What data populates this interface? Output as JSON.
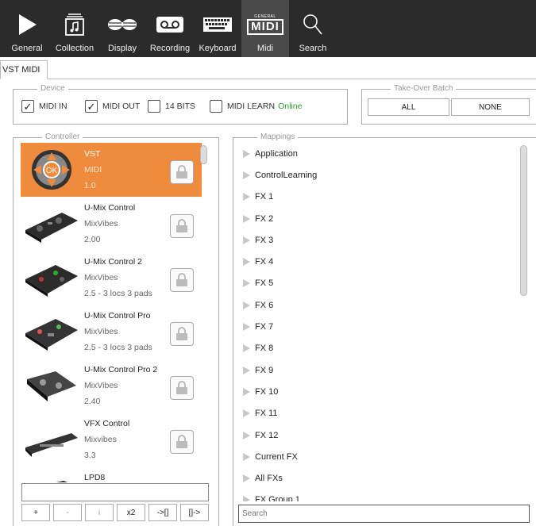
{
  "toolbar": {
    "items": [
      {
        "label": "General",
        "icon": "play-icon"
      },
      {
        "label": "Collection",
        "icon": "collection-icon"
      },
      {
        "label": "Display",
        "icon": "glasses-icon"
      },
      {
        "label": "Recording",
        "icon": "cassette-icon"
      },
      {
        "label": "Keyboard",
        "icon": "keyboard-icon"
      },
      {
        "label": "Midi",
        "icon": "midi-icon",
        "icon_text_top": "GENERAL",
        "icon_text_main": "MIDI",
        "active": true
      },
      {
        "label": "Search",
        "icon": "magnifier-icon"
      }
    ]
  },
  "tabs": [
    {
      "label": "VST MIDI"
    }
  ],
  "device": {
    "title": "Device",
    "midi_in": {
      "label": "MIDI IN",
      "checked": true
    },
    "midi_out": {
      "label": "MIDI OUT",
      "checked": true
    },
    "bits14": {
      "label": "14 BITS",
      "checked": false
    },
    "midi_learn": {
      "label": "MIDI LEARN",
      "checked": false
    },
    "status": "Online",
    "status_color": "#2e9d2e"
  },
  "takeover": {
    "title": "Take-Over Batch",
    "all_label": "ALL",
    "none_label": "NONE"
  },
  "controller": {
    "title": "Controller",
    "selected_color": "#f08a3c",
    "items": [
      {
        "name": "VST",
        "maker": "MIDI",
        "version": "1.0"
      },
      {
        "name": "U-Mix Control",
        "maker": "MixVibes",
        "version": "2.00"
      },
      {
        "name": "U-Mix Control 2",
        "maker": "MixVibes",
        "version": "2.5 - 3 locs 3 pads"
      },
      {
        "name": "U-Mix Control Pro",
        "maker": "MixVibes",
        "version": "2.5 - 3 locs 3 pads"
      },
      {
        "name": "U-Mix Control Pro 2",
        "maker": "MixVibes",
        "version": "2.40"
      },
      {
        "name": "VFX Control",
        "maker": "Mixvibes",
        "version": "3.3"
      },
      {
        "name": "LPD8",
        "maker": "",
        "version": ""
      }
    ],
    "buttons": {
      "add": "+",
      "remove": "-",
      "info": "i",
      "x2": "x2",
      "export": "->[]",
      "import": "[]->"
    },
    "input_value": ""
  },
  "mappings": {
    "title": "Mappings",
    "items": [
      "Application",
      "ControlLearning",
      "FX 1",
      "FX 2",
      "FX 3",
      "FX 4",
      "FX 5",
      "FX 6",
      "FX 7",
      "FX 8",
      "FX 9",
      "FX 10",
      "FX 11",
      "FX 12",
      "Current FX",
      "All FXs",
      "FX Group 1"
    ],
    "search_placeholder": "Search"
  }
}
